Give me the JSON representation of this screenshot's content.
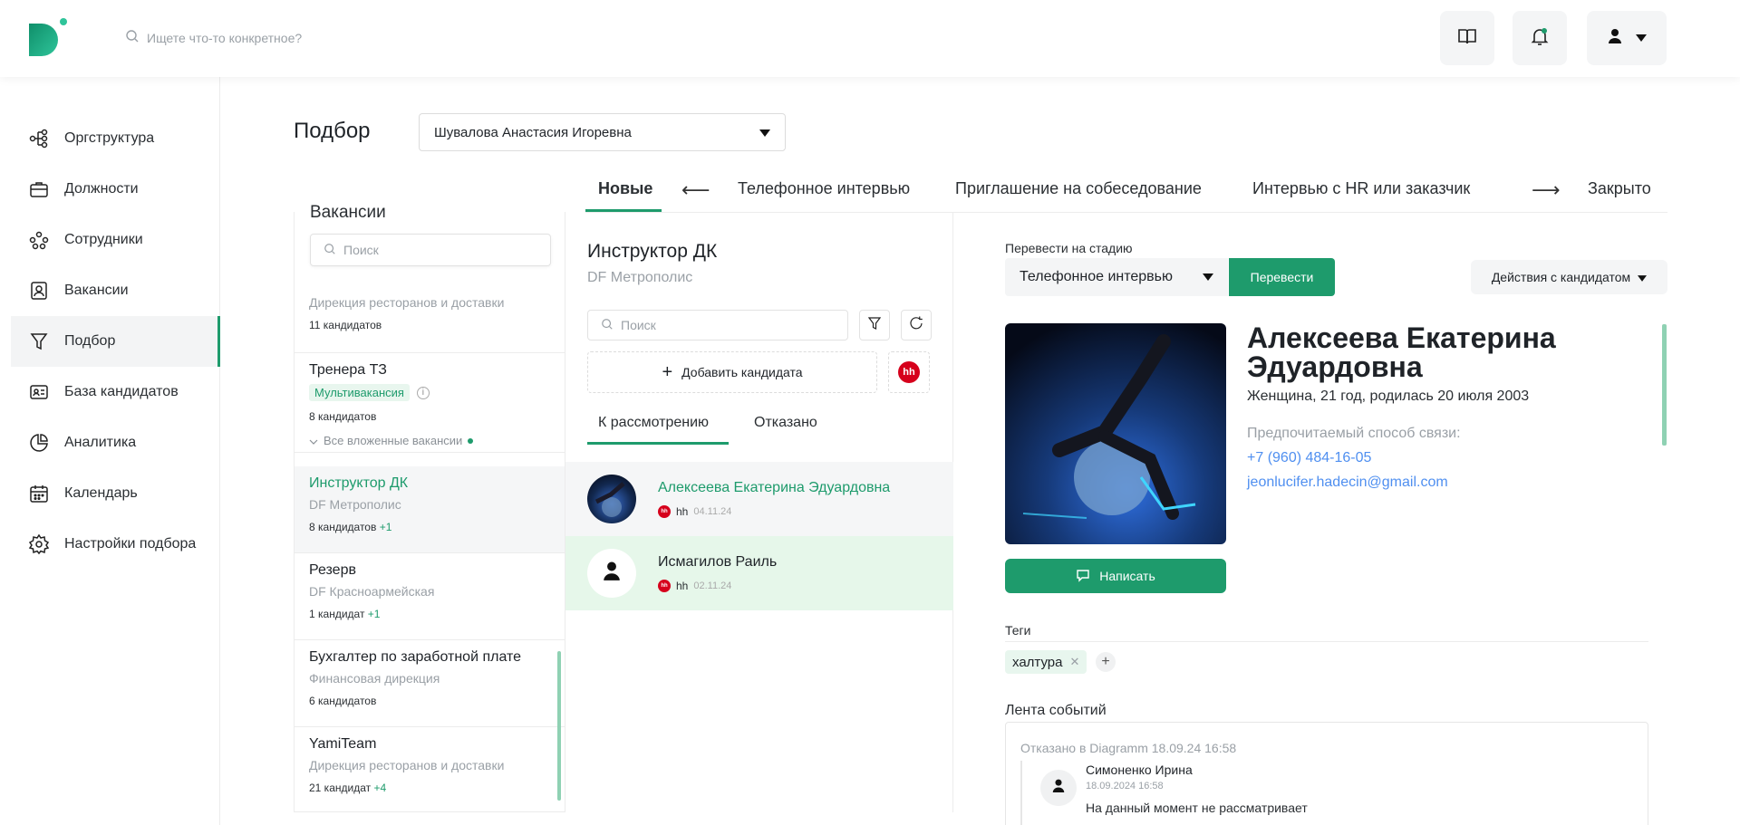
{
  "header": {
    "search_placeholder": "Ищете что-то конкретное?"
  },
  "sidebar": {
    "items": [
      {
        "label": "Оргструктура"
      },
      {
        "label": "Должности"
      },
      {
        "label": "Сотрудники"
      },
      {
        "label": "Вакансии"
      },
      {
        "label": "Подбор"
      },
      {
        "label": "База кандидатов"
      },
      {
        "label": "Аналитика"
      },
      {
        "label": "Календарь"
      },
      {
        "label": "Настройки подбора"
      }
    ]
  },
  "page": {
    "title": "Подбор",
    "recruiter": "Шувалова Анастасия Игоревна"
  },
  "stages": [
    "Новые",
    "Телефонное интервью",
    "Приглашение на собеседование",
    "Интервью с HR или заказчик",
    "Закрыто"
  ],
  "vacancies": {
    "title": "Вакансии",
    "search_placeholder": "Поиск",
    "items": [
      {
        "dept": "Дирекция ресторанов и доставки",
        "count": "11 кандидатов"
      },
      {
        "name": "Тренера ТЗ",
        "badge": "Мультивакансия",
        "info": "i",
        "count": "8 кандидатов",
        "nested": "Все вложенные вакансии"
      },
      {
        "name": "Инструктор ДК",
        "dept": "DF Метрополис",
        "count": "8 кандидатов",
        "plus": "+1"
      },
      {
        "name": "Резерв",
        "dept": "DF Красноармейская",
        "count": "1 кандидат",
        "plus": "+1"
      },
      {
        "name": "Бухгалтер по заработной плате",
        "dept": "Финансовая дирекция",
        "count": "6 кандидатов"
      },
      {
        "name": "YamiTeam",
        "dept": "Дирекция ресторанов и доставки",
        "count": "21 кандидат",
        "plus": "+4"
      }
    ]
  },
  "candidates": {
    "vacancy_title": "Инструктор ДК",
    "vacancy_sub": "DF Метрополис",
    "search_placeholder": "Поиск",
    "add_label": "Добавить кандидата",
    "hh_label": "hh",
    "tabs": [
      "К рассмотрению",
      "Отказано"
    ],
    "list": [
      {
        "name": "Алексеева Екатерина Эдуардовна",
        "source": "hh",
        "date": "04.11.24"
      },
      {
        "name": "Исмагилов Раиль",
        "source": "hh",
        "date": "02.11.24"
      }
    ]
  },
  "detail": {
    "stage_label": "Перевести на стадию",
    "stage_value": "Телефонное интервью",
    "move_label": "Перевести",
    "actions_label": "Действия с кандидатом",
    "name": "Алексеева Екатерина Эдуардовна",
    "info": "Женщина, 21 год, родилась 20 июля 2003",
    "pref_label": "Предпочитаемый способ связи:",
    "phone": "+7 (960) 484-16-05",
    "email": "jeonlucifer.hadecin@gmail.com",
    "write_label": "Написать",
    "tags_label": "Теги",
    "tags": [
      "халтура"
    ],
    "feed_label": "Лента событий",
    "feed": {
      "event": "Отказано в Diagramm 18.09.24 16:58",
      "author": "Симоненко Ирина",
      "date": "18.09.2024 16:58",
      "text": "На данный момент не рассматривает"
    }
  },
  "colors": {
    "accent": "#1e9b6c",
    "link": "#4f8ff0",
    "hh": "#d6001c"
  }
}
